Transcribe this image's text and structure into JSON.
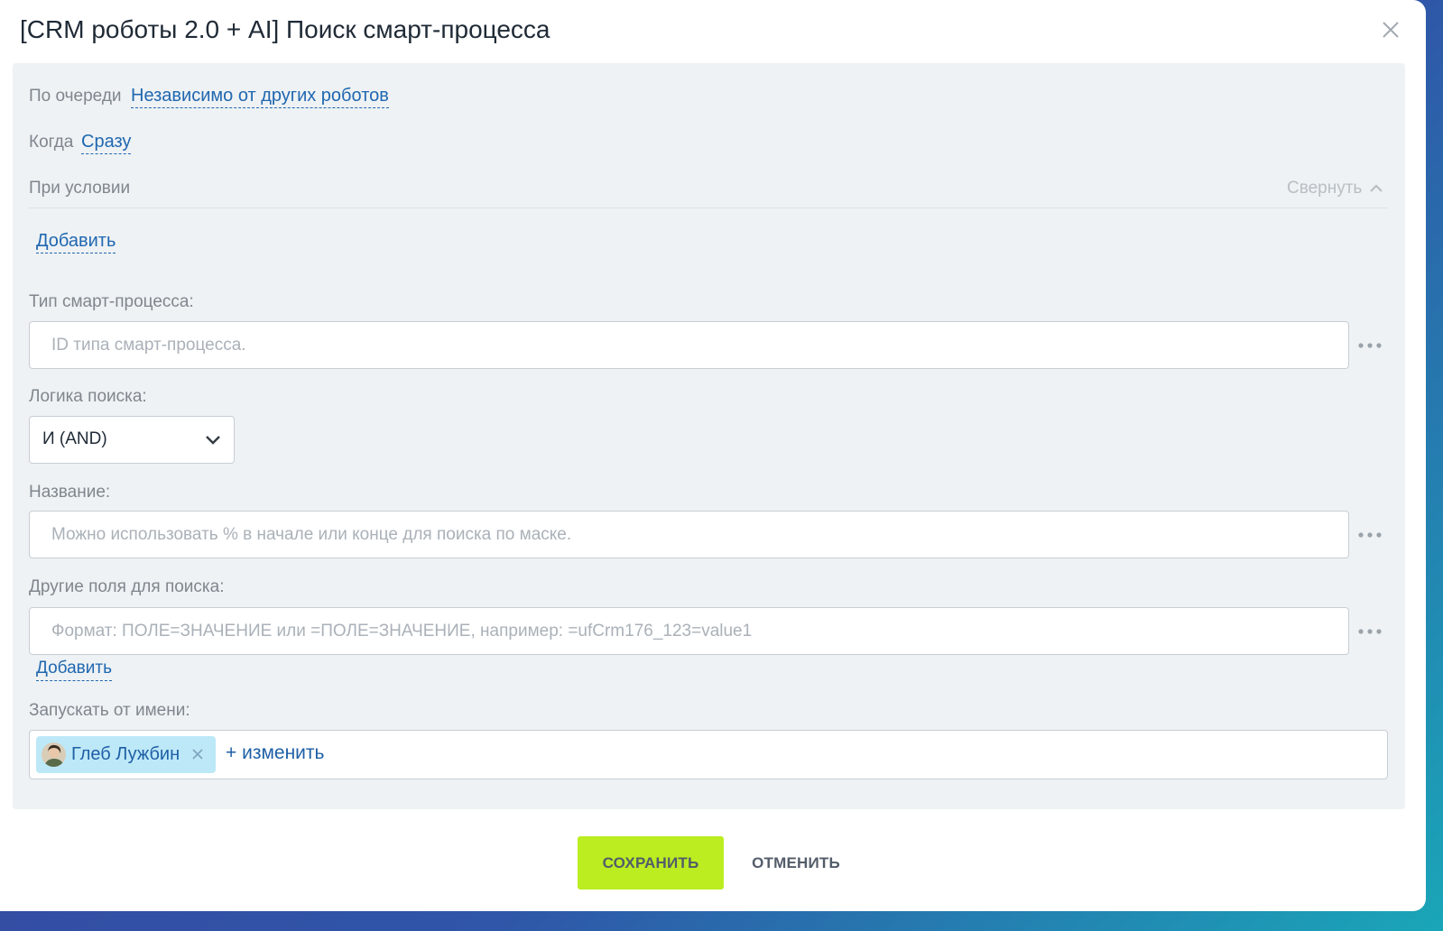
{
  "dialog": {
    "title": "[CRM роботы 2.0 + AI] Поиск смарт-процесса"
  },
  "queue": {
    "label": "По очереди",
    "value": "Независимо от других роботов"
  },
  "when": {
    "label": "Когда",
    "value": "Сразу"
  },
  "condition": {
    "label": "При условии",
    "collapse_label": "Свернуть",
    "add_label": "Добавить"
  },
  "smart_process_type": {
    "label": "Тип смарт-процесса:",
    "placeholder": "ID типа смарт-процесса."
  },
  "search_logic": {
    "label": "Логика поиска:",
    "selected": "И (AND)"
  },
  "name_field": {
    "label": "Название:",
    "placeholder": "Можно использовать % в начале или конце для поиска по маске."
  },
  "other_fields": {
    "label": "Другие поля для поиска:",
    "placeholder": "Формат: ПОЛЕ=ЗНАЧЕНИЕ или =ПОЛЕ=ЗНАЧЕНИЕ, например: =ufCrm176_123=value1",
    "add_label": "Добавить"
  },
  "run_as": {
    "label": "Запускать от имени:",
    "user_name": "Глеб Лужбин",
    "change_label": "+ изменить"
  },
  "footer": {
    "save_label": "СОХРАНИТЬ",
    "cancel_label": "ОТМЕНИТЬ"
  },
  "colors": {
    "link": "#2067b0",
    "save_button": "#bbed21",
    "panel_background": "#eef2f4",
    "chip_background": "#bde8f7"
  },
  "icons": {
    "close": "close-icon",
    "collapse": "chevron-up-icon",
    "more": "more-dots-icon",
    "select": "chevron-down-icon",
    "remove": "remove-x-icon"
  }
}
